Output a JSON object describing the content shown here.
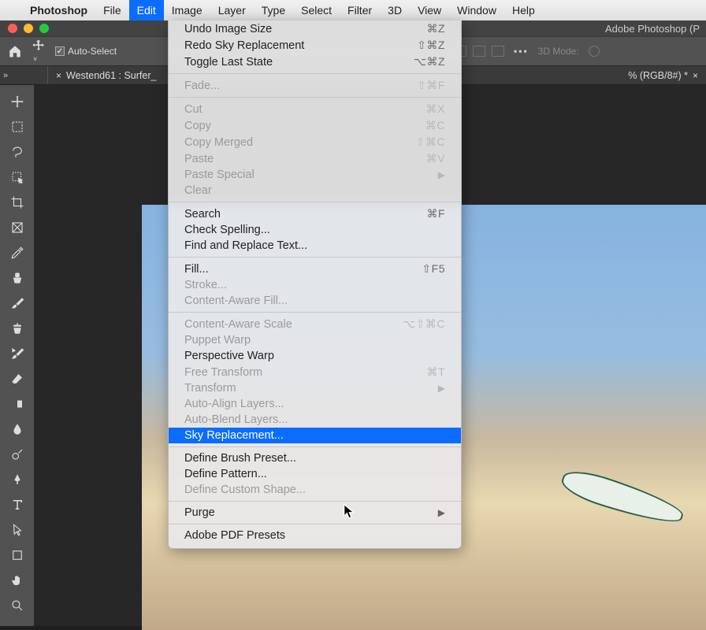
{
  "menubar": {
    "app": "Photoshop",
    "items": [
      "File",
      "Edit",
      "Image",
      "Layer",
      "Type",
      "Select",
      "Filter",
      "3D",
      "View",
      "Window",
      "Help"
    ],
    "selected": "Edit"
  },
  "window_title": "Adobe Photoshop (P",
  "options_bar": {
    "auto_select_label": "Auto-Select",
    "mode_label": "3D Mode:"
  },
  "document_tab": {
    "name_left": "Westend61 : Surfer_",
    "name_right": "% (RGB/8#) *"
  },
  "tools": [
    "move-tool",
    "marquee-tool",
    "lasso-tool",
    "quick-select-tool",
    "crop-tool",
    "frame-tool",
    "eyedropper-tool",
    "healing-brush-tool",
    "brush-tool",
    "clone-stamp-tool",
    "history-brush-tool",
    "eraser-tool",
    "gradient-tool",
    "blur-tool",
    "dodge-tool",
    "pen-tool",
    "type-tool",
    "path-select-tool",
    "shape-tool",
    "hand-tool",
    "zoom-tool"
  ],
  "edit_menu": [
    {
      "label": "Undo Image Size",
      "shortcut": "⌘Z",
      "enabled": true
    },
    {
      "label": "Redo Sky Replacement",
      "shortcut": "⇧⌘Z",
      "enabled": true
    },
    {
      "label": "Toggle Last State",
      "shortcut": "⌥⌘Z",
      "enabled": true
    },
    {
      "sep": true
    },
    {
      "label": "Fade...",
      "shortcut": "⇧⌘F",
      "enabled": false
    },
    {
      "sep": true
    },
    {
      "label": "Cut",
      "shortcut": "⌘X",
      "enabled": false
    },
    {
      "label": "Copy",
      "shortcut": "⌘C",
      "enabled": false
    },
    {
      "label": "Copy Merged",
      "shortcut": "⇧⌘C",
      "enabled": false
    },
    {
      "label": "Paste",
      "shortcut": "⌘V",
      "enabled": false
    },
    {
      "label": "Paste Special",
      "submenu": true,
      "enabled": false
    },
    {
      "label": "Clear",
      "enabled": false
    },
    {
      "sep": true
    },
    {
      "label": "Search",
      "shortcut": "⌘F",
      "enabled": true
    },
    {
      "label": "Check Spelling...",
      "enabled": true
    },
    {
      "label": "Find and Replace Text...",
      "enabled": true
    },
    {
      "sep": true
    },
    {
      "label": "Fill...",
      "shortcut": "⇧F5",
      "enabled": true
    },
    {
      "label": "Stroke...",
      "enabled": false
    },
    {
      "label": "Content-Aware Fill...",
      "enabled": false
    },
    {
      "sep": true
    },
    {
      "label": "Content-Aware Scale",
      "shortcut": "⌥⇧⌘C",
      "enabled": false
    },
    {
      "label": "Puppet Warp",
      "enabled": false
    },
    {
      "label": "Perspective Warp",
      "enabled": true
    },
    {
      "label": "Free Transform",
      "shortcut": "⌘T",
      "enabled": false
    },
    {
      "label": "Transform",
      "submenu": true,
      "enabled": false
    },
    {
      "label": "Auto-Align Layers...",
      "enabled": false
    },
    {
      "label": "Auto-Blend Layers...",
      "enabled": false
    },
    {
      "label": "Sky Replacement...",
      "enabled": true,
      "highlight": true
    },
    {
      "sep": true
    },
    {
      "label": "Define Brush Preset...",
      "enabled": true
    },
    {
      "label": "Define Pattern...",
      "enabled": true
    },
    {
      "label": "Define Custom Shape...",
      "enabled": false
    },
    {
      "sep": true
    },
    {
      "label": "Purge",
      "submenu": true,
      "enabled": true
    },
    {
      "sep": true
    },
    {
      "label": "Adobe PDF Presets",
      "enabled": true
    }
  ]
}
